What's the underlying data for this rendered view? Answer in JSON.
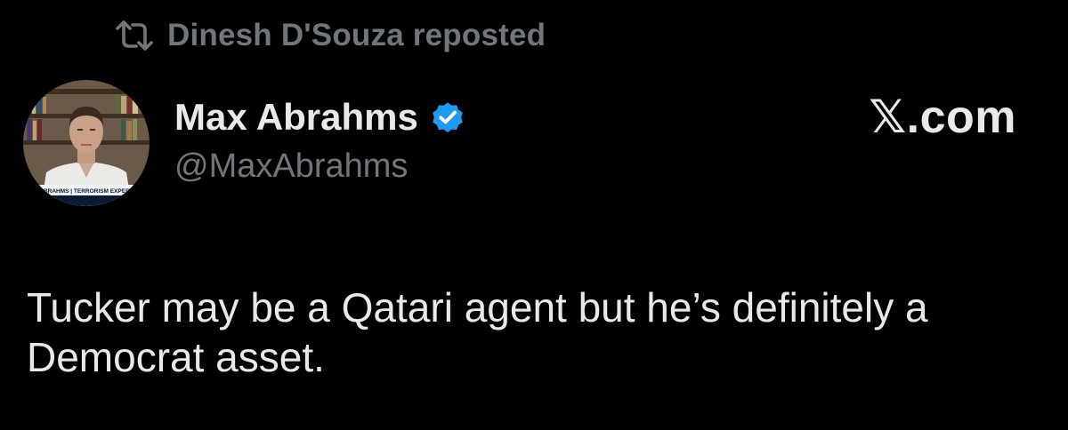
{
  "repost": {
    "label": "Dinesh D'Souza reposted",
    "icon": "repost-icon"
  },
  "author": {
    "display_name": "Max Abrahms",
    "handle": "@MaxAbrahms",
    "verified": true,
    "avatar_caption": "ABRAHMS | TERRORISM EXPERT"
  },
  "watermark": "𝕏.com",
  "post": {
    "text": "Tucker may be a Qatari agent but he’s definitely a Democrat asset."
  },
  "colors": {
    "background": "#000000",
    "primary_text": "#e7e9ea",
    "secondary_text": "#71767b",
    "verified": "#1d9bf0"
  }
}
